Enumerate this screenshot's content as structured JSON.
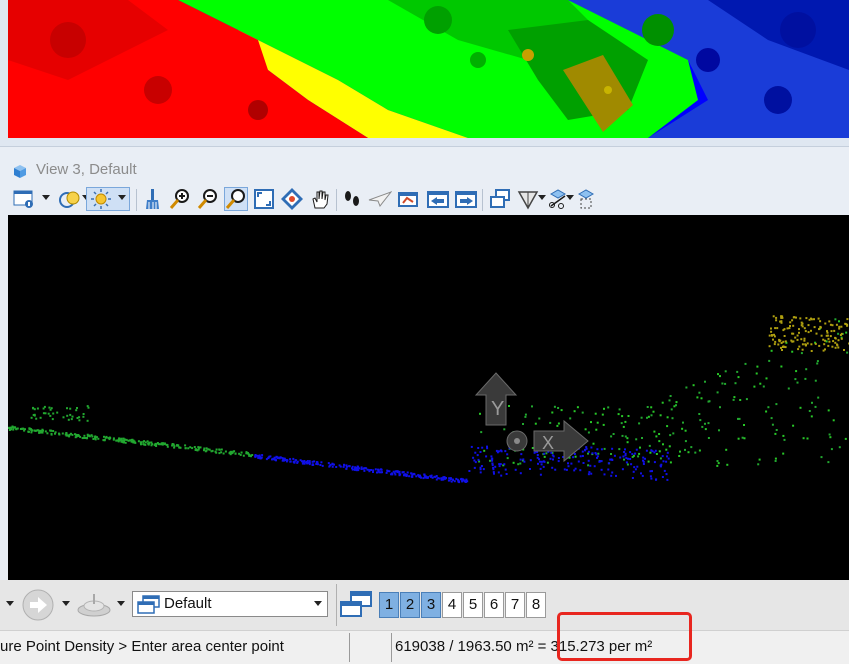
{
  "top_view": {
    "colors": {
      "red": "#ff0000",
      "yellow": "#ffff00",
      "green": "#00ff00",
      "olive": "#9c8a00",
      "blue": "#0000ff",
      "dark_blue": "#0020c0"
    }
  },
  "view3": {
    "title": "View 3, Default",
    "toolbar_icons": [
      "view-attributes-icon",
      "display-style-icon",
      "lighting-icon",
      "brush-icon",
      "zoom-in-icon",
      "zoom-out-icon",
      "window-area-icon",
      "fit-view-icon",
      "rotate-view-icon",
      "pan-view-icon",
      "walk-icon",
      "fly-icon",
      "view-previous-icon",
      "view-next-icon",
      "copy-view-icon",
      "view-rotation-icon",
      "clip-volume-icon",
      "clip-mask-icon"
    ],
    "canvas": {
      "background": "#000000",
      "axis_labels": {
        "y": "Y",
        "x": "X"
      },
      "point_colors": {
        "green": "#22a830",
        "blue": "#1010e8",
        "yellow": "#b0a010",
        "bright_green": "#28c828"
      }
    }
  },
  "bottom_toolbar": {
    "view_select": {
      "selected": "Default"
    },
    "view_numbers": [
      {
        "label": "1",
        "active": true
      },
      {
        "label": "2",
        "active": true
      },
      {
        "label": "3",
        "active": true
      },
      {
        "label": "4",
        "active": false
      },
      {
        "label": "5",
        "active": false
      },
      {
        "label": "6",
        "active": false
      },
      {
        "label": "7",
        "active": false
      },
      {
        "label": "8",
        "active": false
      }
    ]
  },
  "status_bar": {
    "prompt": "ure Point Density > Enter area center point",
    "result": "619038 / 1963.50 m² = 315.273 per m²"
  },
  "annotation": {
    "highlight_color": "#e8261f"
  }
}
